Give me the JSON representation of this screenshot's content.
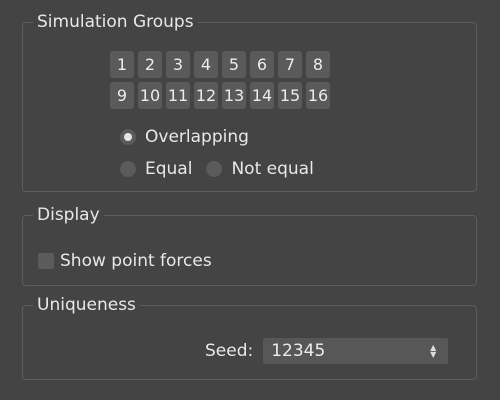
{
  "simulation_groups": {
    "title": "Simulation Groups",
    "numbers": [
      "1",
      "2",
      "3",
      "4",
      "5",
      "6",
      "7",
      "8",
      "9",
      "10",
      "11",
      "12",
      "13",
      "14",
      "15",
      "16"
    ],
    "options": {
      "overlapping": "Overlapping",
      "equal": "Equal",
      "not_equal": "Not equal"
    },
    "selected": "overlapping"
  },
  "display": {
    "title": "Display",
    "show_point_forces_label": "Show point forces",
    "show_point_forces_checked": false
  },
  "uniqueness": {
    "title": "Uniqueness",
    "seed_label": "Seed:",
    "seed_value": "12345"
  },
  "colors": {
    "background": "#444444",
    "button": "#5a5a5a",
    "text": "#e6e6e6"
  }
}
